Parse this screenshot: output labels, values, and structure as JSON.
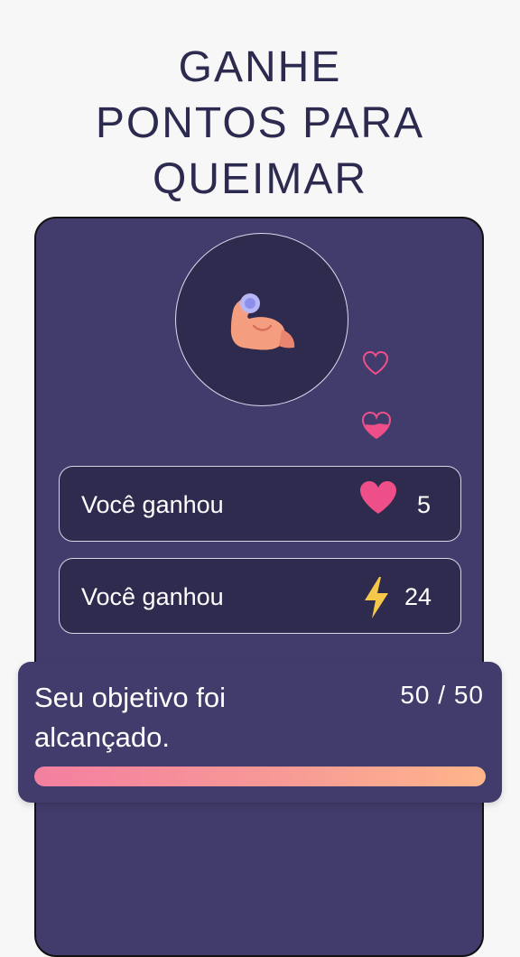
{
  "headline": {
    "line1": "GANHE",
    "line2": "PONTOS PARA",
    "line3": "QUEIMAR"
  },
  "rewards": [
    {
      "label": "Você ganhou",
      "icon": "heart-icon",
      "value": "5",
      "color": "#ef4f88"
    },
    {
      "label": "Você ganhou",
      "icon": "lightning-icon",
      "value": "24",
      "color": "#f5c84a"
    }
  ],
  "goal": {
    "message": "Seu objetivo foi alcançado.",
    "count": "50 / 50",
    "progress_fraction": 1.0
  },
  "colors": {
    "background": "#f7f7f8",
    "panel": "#413c6b",
    "card": "#2f2b4e",
    "accent_pink": "#f47fa0",
    "accent_orange": "#ffb58b",
    "headline": "#2c2b4f"
  },
  "icons": {
    "main": "flexed-bicep-icon",
    "small_1": "heart-outline-icon",
    "small_2": "heart-half-icon"
  }
}
